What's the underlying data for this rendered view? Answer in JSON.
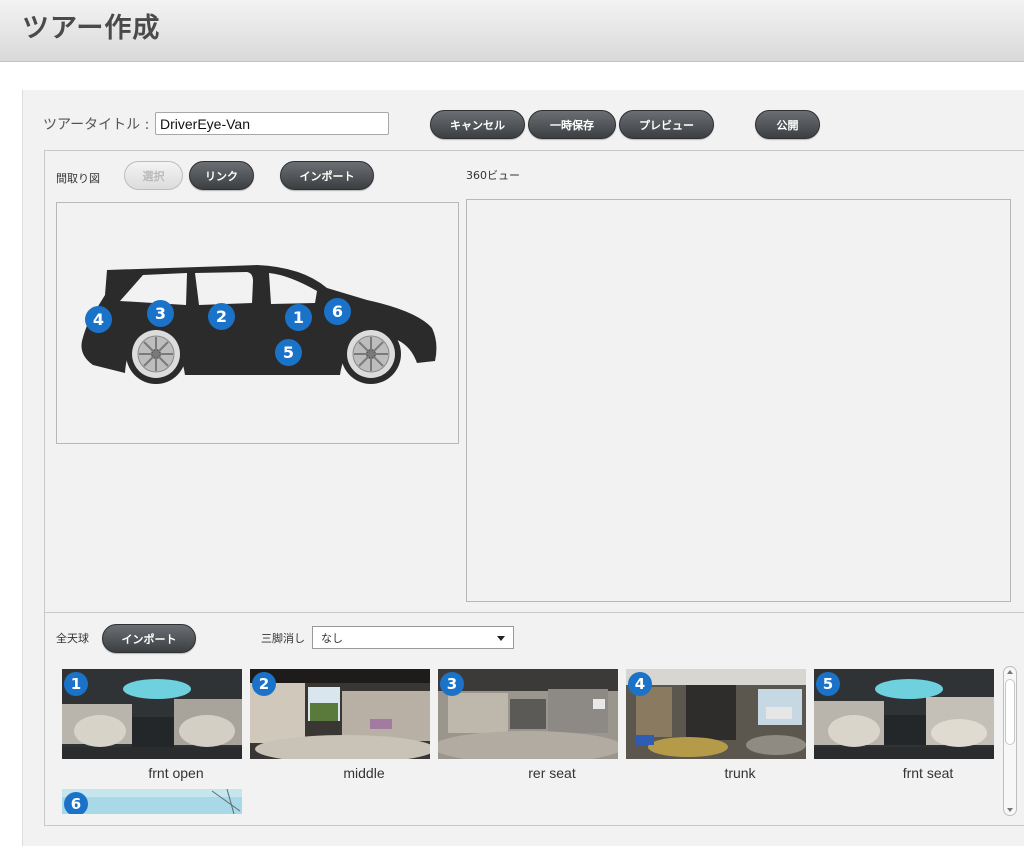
{
  "header": {
    "title": "ツアー作成"
  },
  "tour": {
    "title_label": "ツアータイトル :",
    "title_value": "DriverEye-Van"
  },
  "toolbar": {
    "cancel_label": "キャンセル",
    "save_label": "一時保存",
    "preview_label": "プレビュー",
    "publish_label": "公開"
  },
  "floorplan": {
    "label": "間取り図",
    "select_label": "選択",
    "link_label": "リンク",
    "import_label": "インポート",
    "markers": [
      "4",
      "3",
      "2",
      "1",
      "6",
      "5"
    ]
  },
  "view360": {
    "label": "360ビュー"
  },
  "panorama": {
    "label": "全天球",
    "import_label": "インポート",
    "tripod_label": "三脚消し",
    "tripod_value": "なし",
    "items": [
      {
        "number": "1",
        "name": "frnt open"
      },
      {
        "number": "2",
        "name": "middle"
      },
      {
        "number": "3",
        "name": "rer seat"
      },
      {
        "number": "4",
        "name": "trunk"
      },
      {
        "number": "5",
        "name": "frnt seat"
      },
      {
        "number": "6",
        "name": ""
      }
    ]
  },
  "colors": {
    "marker": "#1a73c8",
    "button_dark": "#4a4d50"
  }
}
